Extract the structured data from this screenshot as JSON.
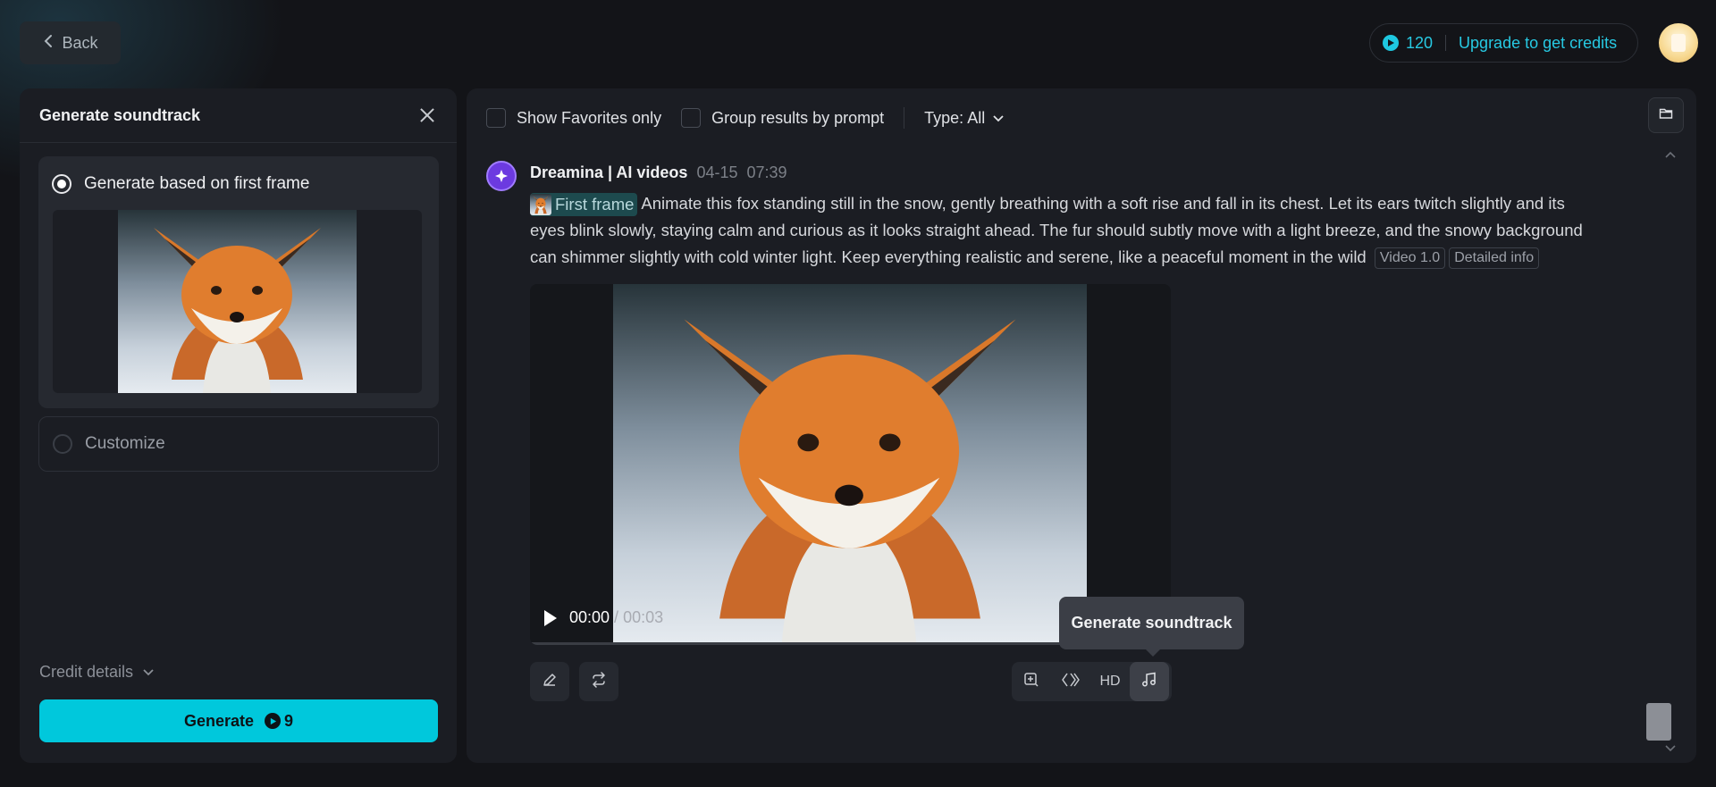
{
  "header": {
    "back_label": "Back",
    "credits": "120",
    "upgrade_label": "Upgrade to get credits"
  },
  "left_panel": {
    "title": "Generate soundtrack",
    "option_first_frame": "Generate based on first frame",
    "option_customize": "Customize",
    "credit_details": "Credit details",
    "generate_label": "Generate",
    "generate_cost": "9"
  },
  "filters": {
    "favorites": "Show Favorites only",
    "group": "Group results by prompt",
    "type": "Type: All"
  },
  "result": {
    "author": "Dreamina | AI videos",
    "date": "04-15",
    "time": "07:39",
    "first_frame_chip": "First frame",
    "prompt": "Animate this fox standing still in the snow, gently breathing with a soft rise and fall in its chest. Let its ears twitch slightly and its eyes blink slowly, staying calm and curious as it looks straight ahead. The fur should subtly move with a light breeze, and the snowy background can shimmer slightly with cold winter light. Keep everything realistic and serene, like a peaceful moment in the wild",
    "model_tag": "Video 1.0",
    "info_tag": "Detailed info",
    "video_current": "00:00",
    "video_sep": " / ",
    "video_duration": "00:03",
    "hd_label": "HD",
    "tooltip": "Generate soundtrack"
  },
  "colors": {
    "accent": "#00c8dc",
    "background": "#131418",
    "panel": "#1b1d23",
    "bot": "#6c3ae0"
  }
}
